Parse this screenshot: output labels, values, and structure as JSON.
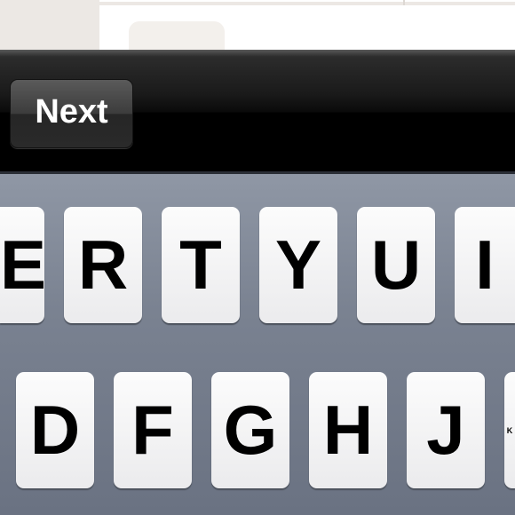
{
  "toolbar": {
    "next_label": "Next"
  },
  "keyboard": {
    "row1": [
      "E",
      "R",
      "T",
      "Y",
      "U",
      "I"
    ],
    "row2": [
      "D",
      "F",
      "G",
      "H",
      "J",
      "K"
    ]
  }
}
